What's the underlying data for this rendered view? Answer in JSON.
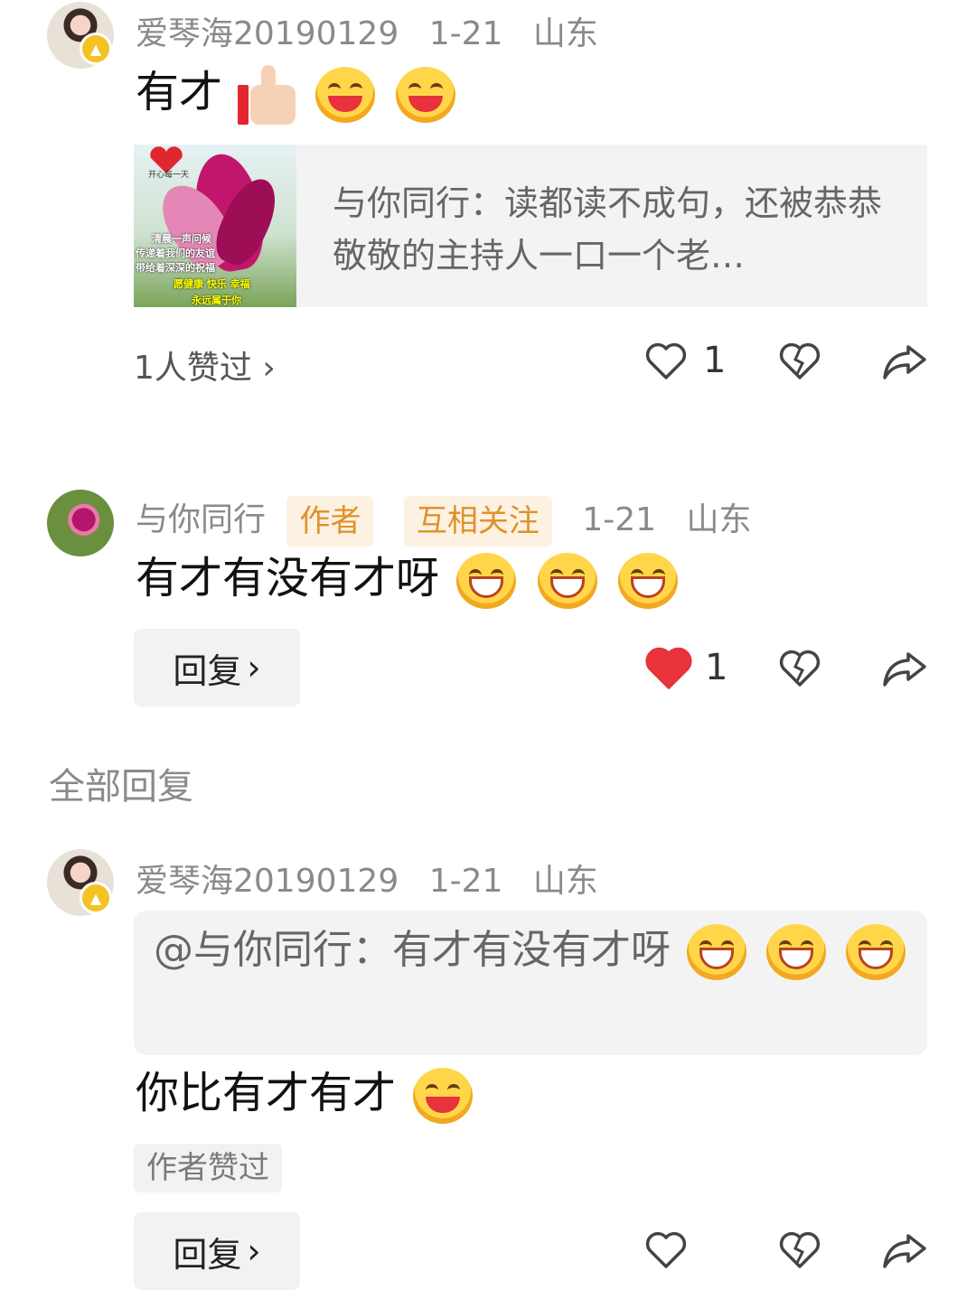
{
  "comment1": {
    "username": "爱琴海20190129",
    "date": "1-21",
    "location": "山东",
    "text": "有才",
    "emojis": [
      "thumbs-up-icon",
      "laughing-face-icon",
      "laughing-face-icon"
    ],
    "shared_card": {
      "text": "与你同行：读都读不成句，还被恭恭敬敬的主持人一口一个老…",
      "image_text": [
        "开心每一天",
        "清晨一声问候",
        "传递着我们的友谊",
        "带给着深深的祝福",
        "愿健康 快乐 幸福",
        "永远属于你"
      ]
    },
    "likes_summary": "1人赞过",
    "like_count": "1"
  },
  "comment2": {
    "username": "与你同行",
    "tags": [
      "作者",
      "互相关注"
    ],
    "date": "1-21",
    "location": "山东",
    "text": "有才有没有才呀",
    "emojis": [
      "grinning-face-icon",
      "grinning-face-icon",
      "grinning-face-icon"
    ],
    "reply_label": "回复",
    "like_count": "1",
    "liked": true
  },
  "replies_section": {
    "title": "全部回复"
  },
  "reply1": {
    "username": "爱琴海20190129",
    "date": "1-21",
    "location": "山东",
    "quote": "@与你同行：有才有没有才呀",
    "quote_emojis": [
      "grinning-face-icon",
      "grinning-face-icon",
      "grinning-face-icon"
    ],
    "text": "你比有才有才",
    "emojis": [
      "laughing-face-icon"
    ],
    "author_liked_label": "作者赞过",
    "reply_label": "回复"
  },
  "colors": {
    "accent_tag_bg": "#fdf1e2",
    "accent_tag_text": "#e0912b",
    "liked_heart": "#e8323c",
    "muted_text": "#8a8a8a"
  }
}
